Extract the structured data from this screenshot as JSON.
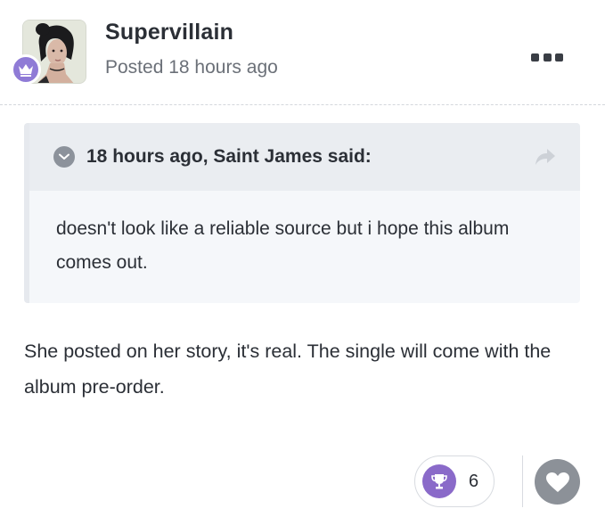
{
  "author": {
    "name": "Supervillain",
    "posted": "Posted 18 hours ago",
    "avatar_icon": "user-avatar-photo",
    "rank_icon": "crown-icon"
  },
  "menu": {
    "icon": "more-icon"
  },
  "quote": {
    "citation": "18 hours ago, Saint James said:",
    "text": "doesn't look like a reliable source but i hope this album comes out.",
    "toggle_icon": "chevron-down-icon",
    "share_icon": "share-arrow-icon"
  },
  "body": {
    "text": "She posted on her story, it's real. The single will come with the album pre-order."
  },
  "reactions": {
    "icon": "trophy-icon",
    "count": "6",
    "like_icon": "heart-icon"
  },
  "colors": {
    "text": "#2b2f36",
    "muted": "#6b7078",
    "rank_badge": "#8f7bd6",
    "trophy": "#8a6ac9",
    "like": "#8c9198"
  }
}
